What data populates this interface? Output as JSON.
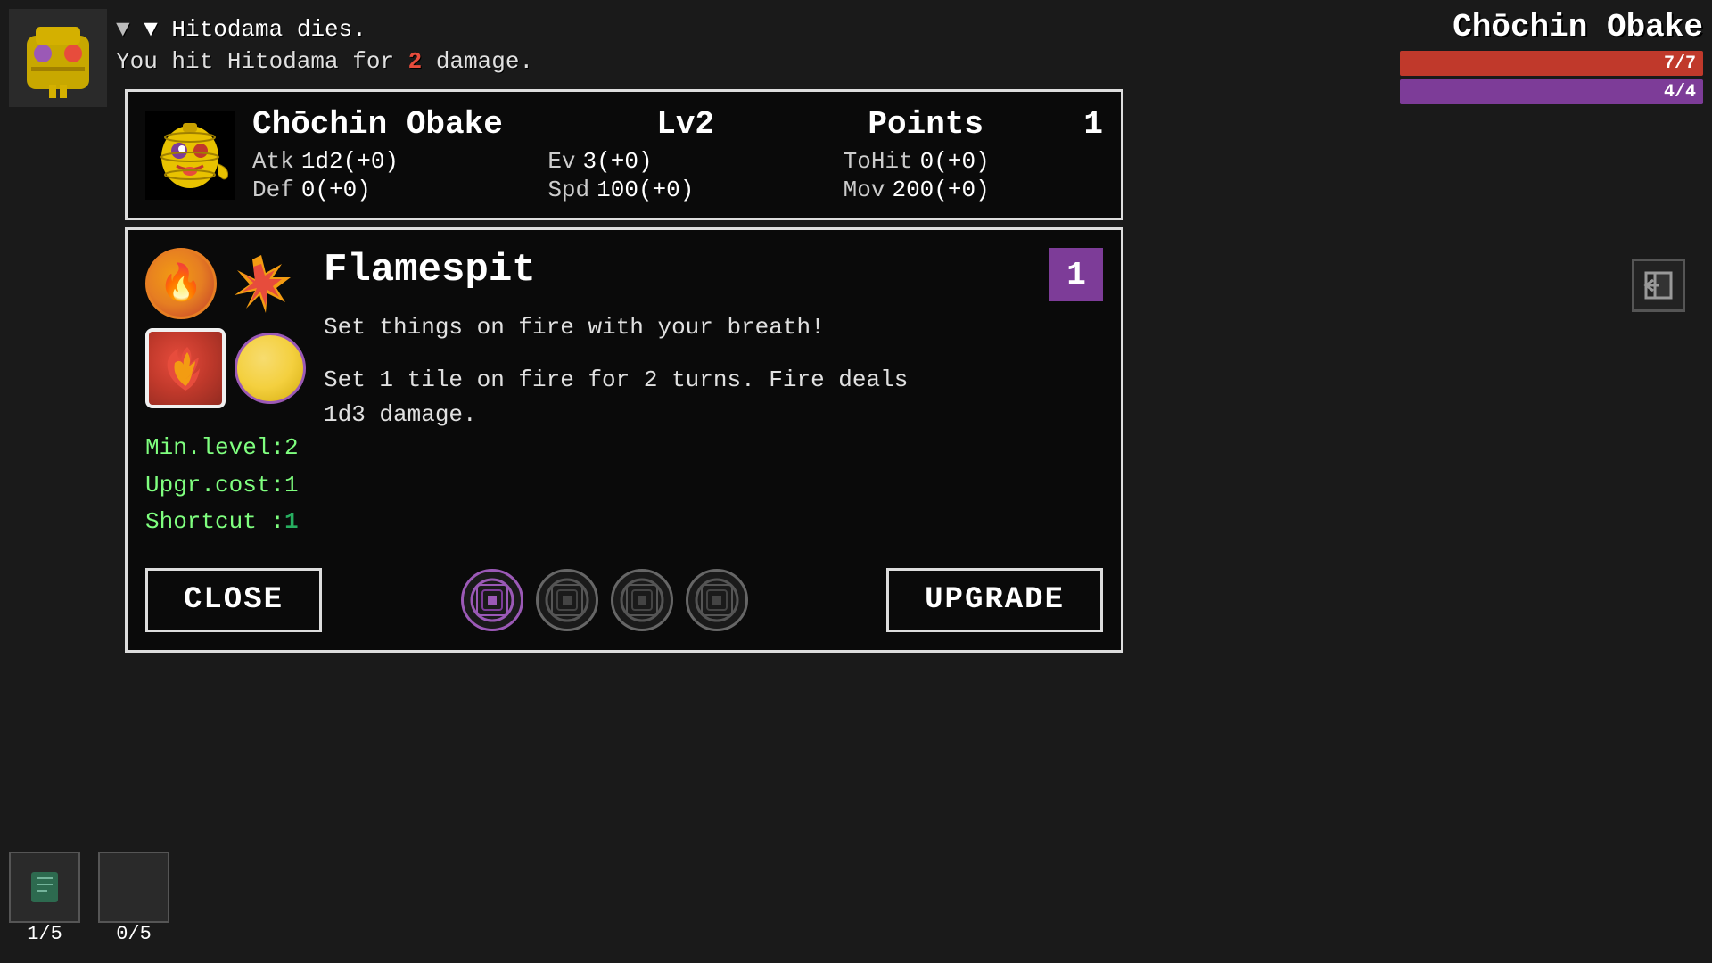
{
  "game": {
    "bg_color": "#111"
  },
  "top_right": {
    "character_name": "Chōchin Obake",
    "hp_current": 7,
    "hp_max": 7,
    "hp_label": "7/7",
    "mp_current": 4,
    "mp_max": 4,
    "mp_label": "4/4"
  },
  "log": {
    "line1": "▼ Hitodama dies.",
    "line2_prefix": "You hit Hitodama for ",
    "line2_damage": "2",
    "line2_suffix": " damage."
  },
  "stats_panel": {
    "char_name": "Chōchin Obake",
    "level_label": "Lv2",
    "points_label": "Points",
    "points_value": "1",
    "atk_label": "Atk",
    "atk_value": "1d2(+0)",
    "ev_label": "Ev",
    "ev_value": "3(+0)",
    "tohit_label": "ToHit",
    "tohit_value": "0(+0)",
    "def_label": "Def",
    "def_value": "0(+0)",
    "spd_label": "Spd",
    "spd_value": "100(+0)",
    "mov_label": "Mov",
    "mov_value": "200(+0)"
  },
  "ability_panel": {
    "name": "Flamespit",
    "level_badge": "1",
    "short_desc": "Set things on fire with your breath!",
    "long_desc": "Set 1 tile on fire for 2 turns. Fire deals",
    "long_desc2": "1d3 damage.",
    "min_level_label": "Min.level:",
    "min_level_value": "2",
    "upgr_cost_label": "Upgr.cost:",
    "upgr_cost_value": "1",
    "shortcut_label": "Shortcut :",
    "shortcut_value": "1"
  },
  "buttons": {
    "close": "CLOSE",
    "upgrade": "UPGRADE"
  },
  "skill_slots": [
    {
      "active": true
    },
    {
      "active": false
    },
    {
      "active": false
    },
    {
      "active": false
    }
  ],
  "bottom_left": {
    "item1_count": "1/5",
    "item2_count": "0/5"
  }
}
